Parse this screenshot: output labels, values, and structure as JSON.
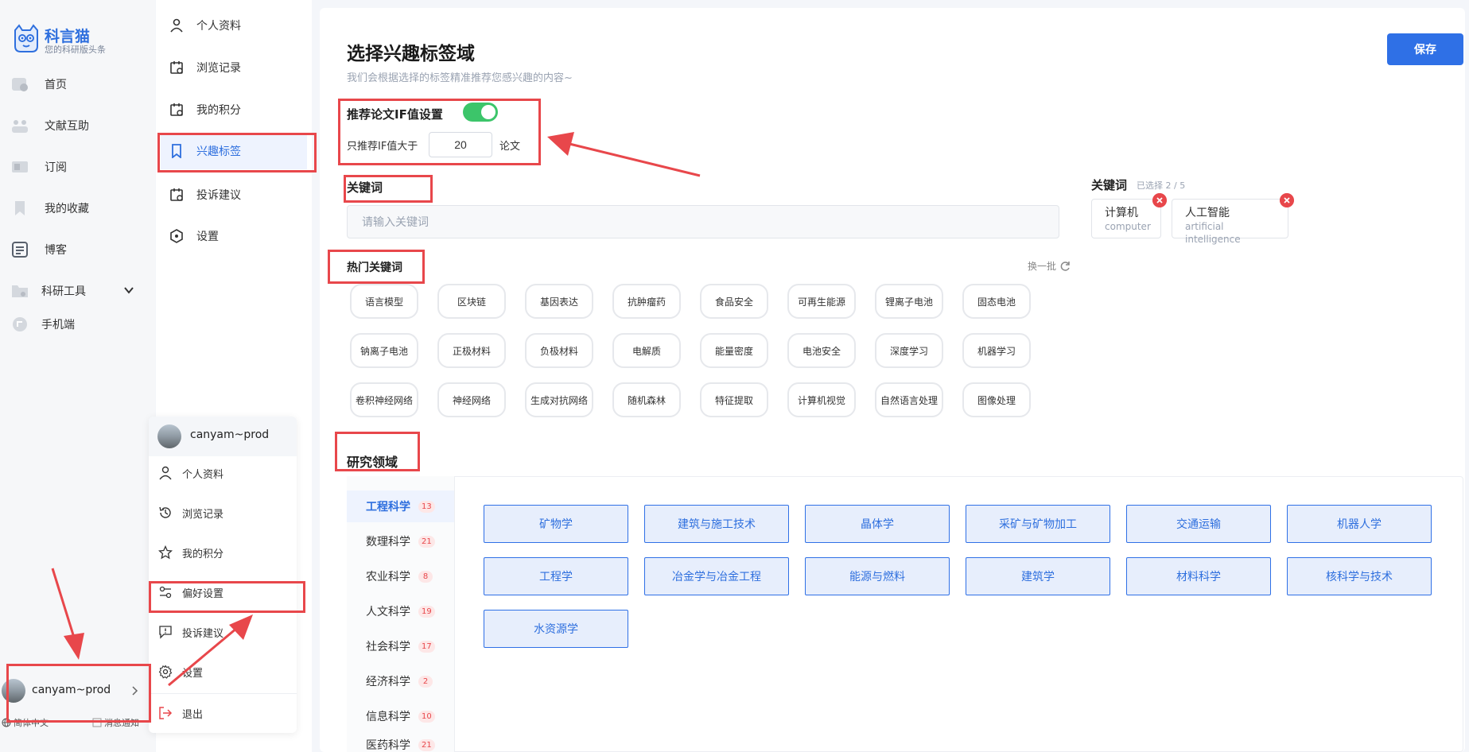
{
  "app": {
    "name": "科言猫",
    "tagline": "您的科研版头条"
  },
  "sidebar": {
    "items": [
      {
        "label": "首页",
        "icon": "home-icon"
      },
      {
        "label": "文献互助",
        "icon": "literature-icon"
      },
      {
        "label": "订阅",
        "icon": "subscribe-icon"
      },
      {
        "label": "我的收藏",
        "icon": "bookmark-icon"
      },
      {
        "label": "博客",
        "icon": "blog-icon"
      },
      {
        "label": "科研工具",
        "icon": "folder-icon"
      },
      {
        "label": "手机端",
        "icon": "mobile-icon"
      }
    ],
    "user": {
      "name": "canyam~prod"
    },
    "footer": {
      "language": "简体中文",
      "notification": "消息通知"
    }
  },
  "settings_nav": {
    "items": [
      {
        "label": "个人资料",
        "icon": "user-icon"
      },
      {
        "label": "浏览记录",
        "icon": "calendar-icon"
      },
      {
        "label": "我的积分",
        "icon": "calendar-icon"
      },
      {
        "label": "兴趣标签",
        "icon": "bookmark-icon",
        "active": true
      },
      {
        "label": "投诉建议",
        "icon": "calendar-icon"
      },
      {
        "label": "设置",
        "icon": "hexagon-icon"
      }
    ]
  },
  "main": {
    "title": "选择兴趣标签域",
    "subtitle": "我们会根据选择的标签精准推荐您感兴趣的内容~",
    "save_label": "保存",
    "if_setting": {
      "label": "推荐论文IF值设置",
      "enabled": true,
      "prefix": "只推荐IF值大于",
      "value": "20",
      "suffix": "论文"
    },
    "keywords": {
      "label": "关键词",
      "placeholder": "请输入关键词",
      "selected_label": "关键词",
      "selected_count": "已选择 2 / 5",
      "selected": [
        {
          "zh": "计算机",
          "en": "computer"
        },
        {
          "zh": "人工智能",
          "en": "artificial intelligence"
        }
      ]
    },
    "hot_keywords": {
      "label": "热门关键词",
      "refresh_label": "换一批",
      "items": [
        "语言模型",
        "区块链",
        "基因表达",
        "抗肿瘤药",
        "食品安全",
        "可再生能源",
        "锂离子电池",
        "固态电池",
        "钠离子电池",
        "正极材料",
        "负极材料",
        "电解质",
        "能量密度",
        "电池安全",
        "深度学习",
        "机器学习",
        "卷积神经网络",
        "神经网络",
        "生成对抗网络",
        "随机森林",
        "特征提取",
        "计算机视觉",
        "自然语言处理",
        "图像处理"
      ]
    },
    "research_fields": {
      "label": "研究领域",
      "categories": [
        {
          "label": "工程科学",
          "count": "13",
          "active": true
        },
        {
          "label": "数理科学",
          "count": "21"
        },
        {
          "label": "农业科学",
          "count": "8"
        },
        {
          "label": "人文科学",
          "count": "19"
        },
        {
          "label": "社会科学",
          "count": "17"
        },
        {
          "label": "经济科学",
          "count": "2"
        },
        {
          "label": "信息科学",
          "count": "10"
        },
        {
          "label": "医药科学",
          "count": "21"
        }
      ],
      "subfields": [
        "矿物学",
        "建筑与施工技术",
        "晶体学",
        "采矿与矿物加工",
        "交通运输",
        "机器人学",
        "工程学",
        "冶金学与冶金工程",
        "能源与燃料",
        "建筑学",
        "材料科学",
        "核科学与技术",
        "水资源学"
      ]
    }
  },
  "user_menu": {
    "name": "canyam~prod",
    "items": [
      {
        "label": "个人资料",
        "icon": "user-icon"
      },
      {
        "label": "浏览记录",
        "icon": "history-icon"
      },
      {
        "label": "我的积分",
        "icon": "star-icon"
      },
      {
        "label": "偏好设置",
        "icon": "sliders-icon"
      },
      {
        "label": "投诉建议",
        "icon": "feedback-icon"
      },
      {
        "label": "设置",
        "icon": "gear-icon"
      },
      {
        "label": "退出",
        "icon": "logout-icon"
      }
    ]
  },
  "colors": {
    "accent": "#2f70e6",
    "annotation": "#e8474b",
    "toggle_on": "#3cc56a"
  }
}
